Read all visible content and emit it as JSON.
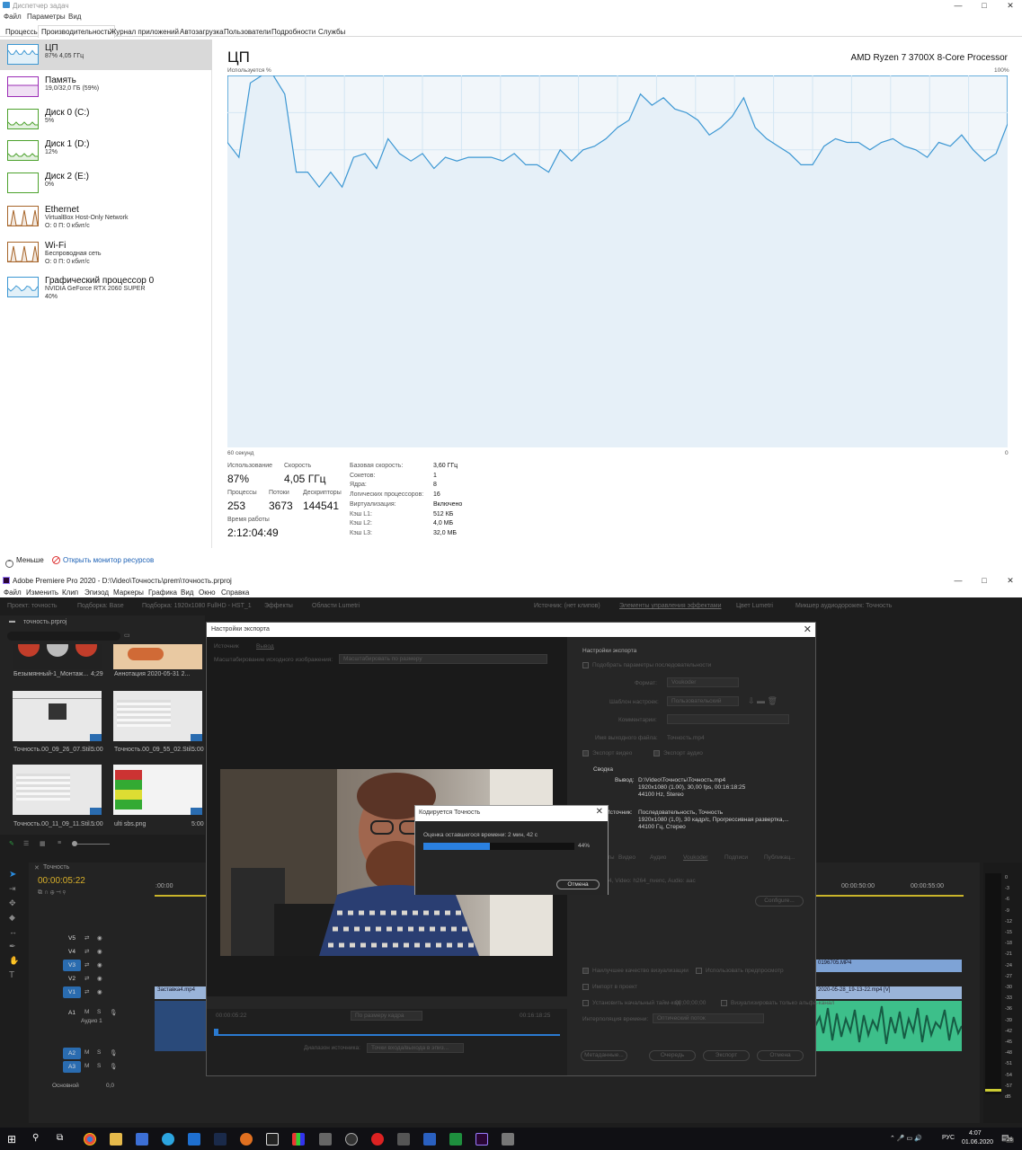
{
  "taskmanager": {
    "title": "Диспетчер задач",
    "window_controls": {
      "minimize": "—",
      "maximize": "□",
      "close": "✕"
    },
    "menu": [
      "Файл",
      "Параметры",
      "Вид"
    ],
    "tabs": [
      "Процессы",
      "Производительность",
      "Журнал приложений",
      "Автозагрузка",
      "Пользователи",
      "Подробности",
      "Службы"
    ],
    "active_tab": "Производительность",
    "resources": [
      {
        "name": "ЦП",
        "sub1": "87% 4,05 ГГц",
        "sub2": "",
        "color": "#3c97d3",
        "active": true
      },
      {
        "name": "Память",
        "sub1": "19,0/32,0 ГБ (59%)",
        "sub2": "",
        "color": "#9b2cb6"
      },
      {
        "name": "Диск 0 (C:)",
        "sub1": "5%",
        "sub2": "",
        "color": "#4da22d"
      },
      {
        "name": "Диск 1 (D:)",
        "sub1": "12%",
        "sub2": "",
        "color": "#4da22d"
      },
      {
        "name": "Диск 2 (E:)",
        "sub1": "0%",
        "sub2": "",
        "color": "#4da22d"
      },
      {
        "name": "Ethernet",
        "sub1": "VirtualBox Host-Only Network",
        "sub2": "О: 0 П: 0 кбит/с",
        "color": "#a7652a"
      },
      {
        "name": "Wi-Fi",
        "sub1": "Беспроводная сеть",
        "sub2": "О: 0 П: 0 кбит/с",
        "color": "#a7652a"
      },
      {
        "name": "Графический процессор 0",
        "sub1": "NVIDIA GeForce RTX 2060 SUPER",
        "sub2": "40%",
        "color": "#3c97d3"
      }
    ],
    "cpu": {
      "title": "ЦП",
      "model": "AMD Ryzen 7 3700X 8-Core Processor",
      "graph_label_left": "Используется %",
      "graph_label_right": "100%",
      "axis_bottom_left": "60 секунд",
      "axis_bottom_right": "0",
      "history_percent": [
        82,
        78,
        98,
        100,
        100,
        95,
        74,
        74,
        70,
        74,
        70,
        78,
        79,
        75,
        83,
        79,
        77,
        79,
        75,
        78,
        77,
        78,
        78,
        78,
        77,
        79,
        76,
        76,
        74,
        80,
        77,
        80,
        81,
        83,
        86,
        88,
        95,
        92,
        94,
        91,
        90,
        88,
        84,
        86,
        89,
        94,
        86,
        83,
        81,
        79,
        76,
        76,
        81,
        83,
        82,
        82,
        80,
        82,
        83,
        81,
        80,
        78,
        82,
        81,
        84,
        80,
        77,
        79,
        87
      ],
      "stats": {
        "usage_label": "Использование",
        "usage": "87%",
        "speed_label": "Скорость",
        "speed": "4,05 ГГц",
        "processes_label": "Процессы",
        "processes": "253",
        "threads_label": "Потоки",
        "threads": "3673",
        "handles_label": "Дескрипторы",
        "handles": "144541",
        "uptime_label": "Время работы",
        "uptime": "2:12:04:49"
      },
      "details": [
        {
          "k": "Базовая скорость:",
          "v": "3,60 ГГц"
        },
        {
          "k": "Сокетов:",
          "v": "1"
        },
        {
          "k": "Ядра:",
          "v": "8"
        },
        {
          "k": "Логических процессоров:",
          "v": "16"
        },
        {
          "k": "Виртуализация:",
          "v": "Включено"
        },
        {
          "k": "Кэш L1:",
          "v": "512 КБ"
        },
        {
          "k": "Кэш L2:",
          "v": "4,0 МБ"
        },
        {
          "k": "Кэш L3:",
          "v": "32,0 МБ"
        }
      ]
    },
    "footer": {
      "less": "Меньше",
      "resource_monitor": "Открыть монитор ресурсов"
    }
  },
  "premiere": {
    "title": "Adobe Premiere Pro 2020 - D:\\Video\\Точность\\prem\\точность.prproj",
    "menu": [
      "Файл",
      "Изменить",
      "Клип",
      "Эпизод",
      "Маркеры",
      "Графика",
      "Вид",
      "Окно",
      "Справка"
    ],
    "top_tabs_left": [
      "Проект: точность",
      "Подборка: Base",
      "Подборка: 1920x1080 FullHD - HST_1",
      "Эффекты",
      "Области Lumetri"
    ],
    "top_tabs_right": [
      "Источник: (нет клипов)",
      "Элементы управления эффектами",
      "Цвет Lumetri",
      "Микшер аудиодорожек: Точность"
    ],
    "project_file": "точность.prproj",
    "project_items": [
      {
        "name": "Безымянный-1_Монтаж...",
        "dur": "4;29"
      },
      {
        "name": "Аннотация 2020-05-31 2...",
        "dur": ""
      },
      {
        "name": "Точность.00_09_26_07.Stil...",
        "dur": "5:00"
      },
      {
        "name": "Точность.00_09_55_02.Stil...",
        "dur": "5:00"
      },
      {
        "name": "Точность.00_11_09_11.Stil...",
        "dur": "5:00"
      },
      {
        "name": "ulti sbs.png",
        "dur": "5:00"
      }
    ],
    "timeline": {
      "tab": "Точность",
      "timecode": "00:00:05:22",
      "ruler_left": ":00:00",
      "ruler_right": [
        "00:00:50:00",
        "00:00:55:00"
      ],
      "video_tracks": [
        "V5",
        "V4",
        "V3",
        "V2",
        "V1"
      ],
      "audio_tracks": [
        "A1",
        "A2",
        "A3"
      ],
      "a1_name": "Аудио 1",
      "master": "Основной",
      "master_val": "0,0",
      "clip_v1_left": "Заставка4.mp4",
      "clip_v3_right": "0196705.MP4",
      "clip_v1_right": "2020-05-28_19-13-22.mp4 [V]",
      "meter_scale": [
        "0",
        "-3",
        "-6",
        "-9",
        "-12",
        "-15",
        "-18",
        "-21",
        "-24",
        "-27",
        "-30",
        "-33",
        "-36",
        "-39",
        "-42",
        "-45",
        "-48",
        "-51",
        "-54",
        "-57",
        "dB"
      ]
    },
    "export_dialog": {
      "title": "Настройки экспорта",
      "tabs": [
        "Источник",
        "Вывод"
      ],
      "scale_label": "Масштабирование исходного изображения:",
      "scale_value": "Масштабировать по размеру",
      "section": "Настройки экспорта",
      "match_seq": "Подобрать параметры последовательности",
      "format_label": "Формат:",
      "format_value": "Voukoder",
      "preset_label": "Шаблон настроек:",
      "preset_value": "Пользовательский",
      "comments_label": "Комментарии:",
      "output_label": "Имя выходного файла:",
      "output_value": "Точность.mp4",
      "export_video": "Экспорт видео",
      "export_audio": "Экспорт аудио",
      "summary": "Сводка",
      "out_label": "Вывод:",
      "out_lines": [
        "D:\\Video\\Точность\\Точность.mp4",
        "1920x1080 (1.00), 30,00 fps, 00:16:18:25",
        "44100 Hz, Stereo"
      ],
      "src_label": "Источник:",
      "src_lines": [
        "Последовательность, Точность",
        "1920x1080 (1,0), 30 кадр/с, Прогрессивная развертка,...",
        "44100 Гц, Стерео"
      ],
      "lower_tabs": [
        "Эффекты",
        "Видео",
        "Аудио",
        "Voukoder",
        "Подписи",
        "Публикац..."
      ],
      "codec_info": "mp4, Video: h264_nvenc, Audio: aac",
      "configure": "Configure...",
      "max_quality": "Наилучшее качество визуализации",
      "use_previews": "Использовать предпросмотр",
      "import_project": "Импорт в проект",
      "start_tc": "Установить начальный тайм-код",
      "start_tc_val": "00;00;00;00",
      "alpha_only": "Визуализировать только альфа-канал",
      "interp_label": "Интерполяция времени:",
      "interp_value": "Оптический поток",
      "metadata_btn": "Метаданные...",
      "queue_btn": "Очередь",
      "export_btn": "Экспорт",
      "cancel_btn": "Отмена",
      "tc_left": "00:00:05:22",
      "tc_right": "00:16:18:25",
      "fit_value": "По размеру кадра",
      "range_label": "Диапазон источника:",
      "range_value": "Точки входа/выхода в эпиз..."
    },
    "progress_dialog": {
      "title": "Кодируется Точность",
      "remaining": "Оценка оставшегося времени: 2 мин, 42 с",
      "percent_text": "44%",
      "progress": 0.44,
      "cancel": "Отмена"
    }
  },
  "taskbar": {
    "lang": "РУС",
    "time": "4:07",
    "date": "01.06.2020",
    "notif": "26"
  }
}
